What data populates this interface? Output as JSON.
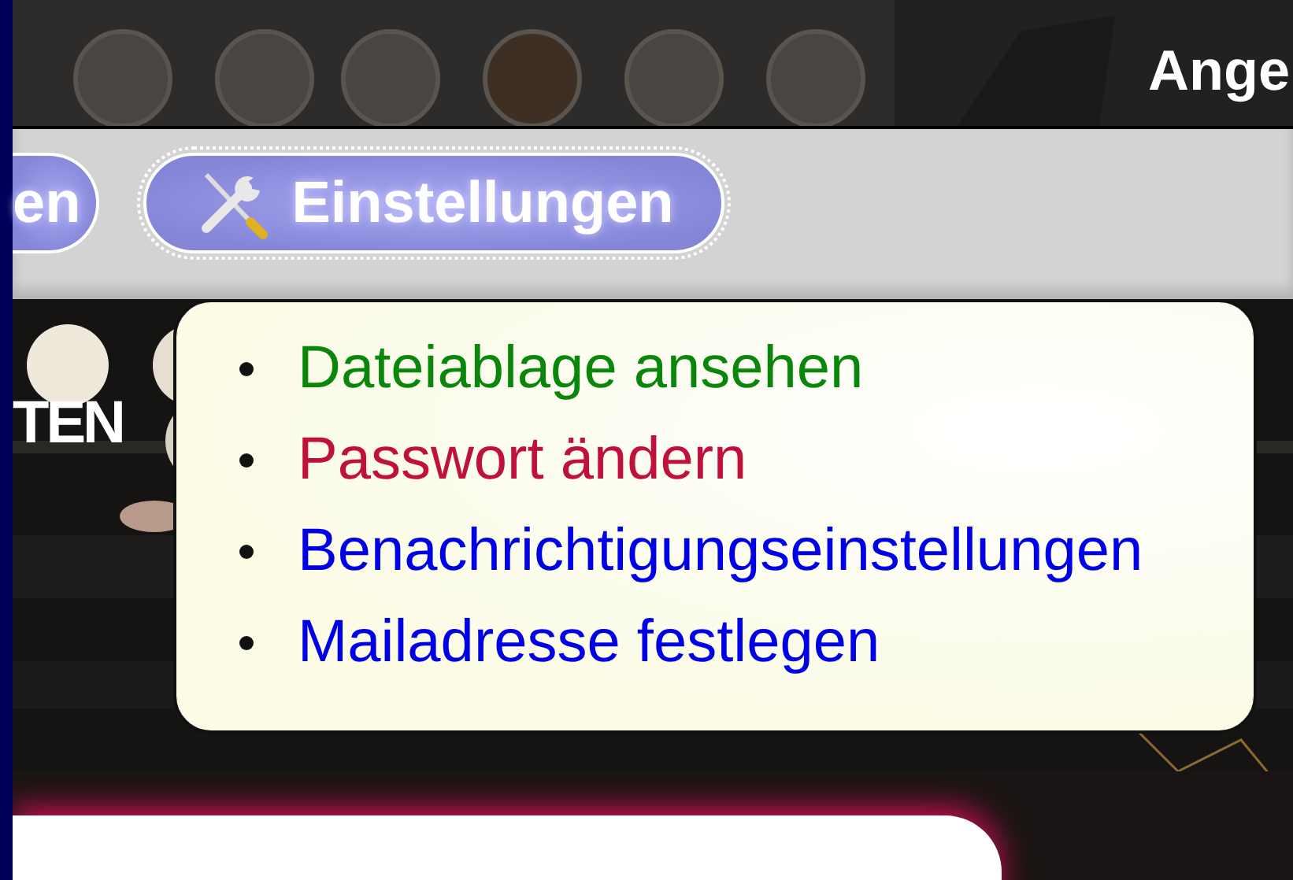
{
  "header": {
    "title": "Ange"
  },
  "nav": {
    "buttons": [
      {
        "label": "en",
        "kind": "plain",
        "focused": false
      },
      {
        "label": "Einstellungen",
        "kind": "tools",
        "focused": true
      }
    ]
  },
  "banner": {
    "title": "TEN"
  },
  "dropdown": {
    "items": [
      {
        "label": "Dateiablage ansehen",
        "color": "#0a870a"
      },
      {
        "label": "Passwort ändern",
        "color": "#c0103c"
      },
      {
        "label": "Benachrichtigungseinstellungen",
        "color": "#0000e6"
      },
      {
        "label": "Mailadresse festlegen",
        "color": "#0000e6"
      }
    ]
  }
}
